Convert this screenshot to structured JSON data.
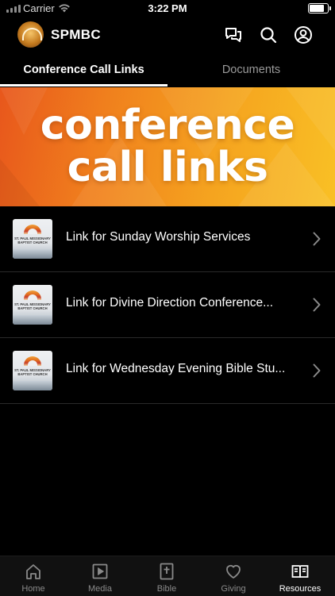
{
  "status_bar": {
    "carrier": "Carrier",
    "time": "3:22 PM",
    "battery_level": 0.9
  },
  "header": {
    "title": "SPMBC"
  },
  "tabs": [
    {
      "label": "Conference Call Links",
      "active": true
    },
    {
      "label": "Documents",
      "active": false
    }
  ],
  "banner": {
    "line1": "conference",
    "line2": "call links"
  },
  "list": [
    {
      "label": "Link for Sunday Worship Services",
      "thumb_text": "ST. PAUL MISSIONARY BAPTIST CHURCH"
    },
    {
      "label": "Link for Divine Direction Conference...",
      "thumb_text": "ST. PAUL MISSIONARY BAPTIST CHURCH"
    },
    {
      "label": "Link for Wednesday Evening Bible Stu...",
      "thumb_text": "ST. PAUL MISSIONARY BAPTIST CHURCH"
    }
  ],
  "bottom_nav": [
    {
      "label": "Home",
      "icon": "home-icon",
      "active": false
    },
    {
      "label": "Media",
      "icon": "media-icon",
      "active": false
    },
    {
      "label": "Bible",
      "icon": "bible-icon",
      "active": false
    },
    {
      "label": "Giving",
      "icon": "heart-icon",
      "active": false
    },
    {
      "label": "Resources",
      "icon": "resources-icon",
      "active": true
    }
  ],
  "colors": {
    "background": "#000000",
    "banner_start": "#e8571c",
    "banner_end": "#f9c025",
    "inactive": "#8a8a8a"
  }
}
